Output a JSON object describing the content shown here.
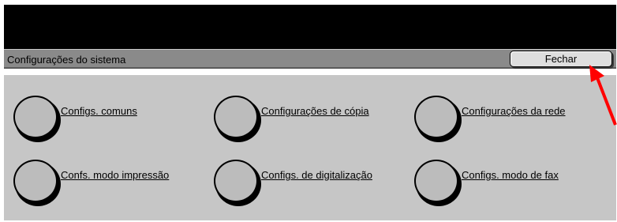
{
  "window": {
    "title": "Configurações do sistema",
    "close_label": "Fechar"
  },
  "options": [
    {
      "label": "Configs. comuns"
    },
    {
      "label": "Configurações de cópia"
    },
    {
      "label": "Configurações da rede"
    },
    {
      "label": "Confs. modo impressão"
    },
    {
      "label": "Configs. de digitalização"
    },
    {
      "label": "Configs. modo de fax"
    }
  ],
  "colors": {
    "header_background": "#000000",
    "title_bar": "#8a8a8a",
    "panel": "#c6c6c6",
    "pointer": "#ff0000"
  },
  "icons": {
    "option_button": "round-button-icon",
    "pointer": "red-arrow-pointer-icon"
  }
}
